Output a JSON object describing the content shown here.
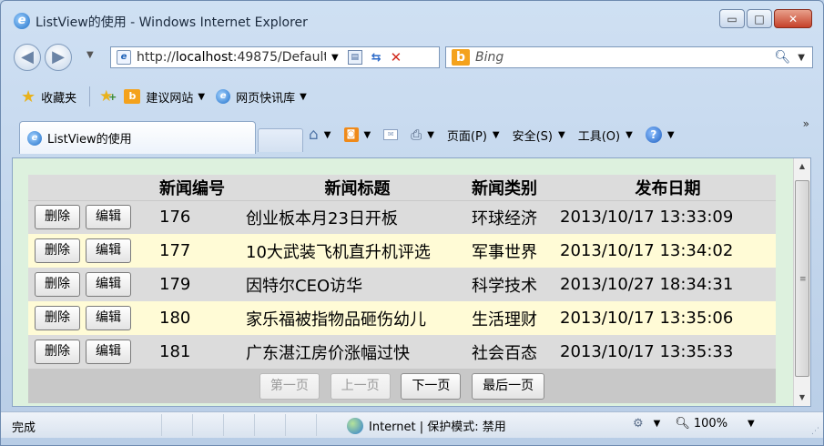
{
  "window": {
    "title": "ListView的使用 - Windows Internet Explorer",
    "minimize_glyph": "▭",
    "maximize_glyph": "□",
    "close_glyph": "✕"
  },
  "address": {
    "url_prefix": "http://",
    "url_host": "localhost",
    "url_rest": ":49875/Default",
    "search_placeholder": "Bing"
  },
  "favorites": {
    "label": "收藏夹",
    "items": [
      {
        "label": "建议网站"
      },
      {
        "label": "网页快讯库"
      }
    ]
  },
  "tab": {
    "label": "ListView的使用"
  },
  "commands": {
    "page": "页面(P)",
    "safety": "安全(S)",
    "tools": "工具(O)"
  },
  "listview": {
    "headers": [
      "新闻编号",
      "新闻标题",
      "新闻类别",
      "发布日期"
    ],
    "delete_label": "删除",
    "edit_label": "编辑",
    "rows": [
      {
        "id": "176",
        "title": "创业板本月23日开板",
        "category": "环球经济",
        "date": "2013/10/17 13:33:09"
      },
      {
        "id": "177",
        "title": "10大武装飞机直升机评选",
        "category": "军事世界",
        "date": "2013/10/17 13:34:02"
      },
      {
        "id": "179",
        "title": "因特尔CEO访华",
        "category": "科学技术",
        "date": "2013/10/27 18:34:31"
      },
      {
        "id": "180",
        "title": "家乐福被指物品砸伤幼儿",
        "category": "生活理财",
        "date": "2013/10/17 13:35:06"
      },
      {
        "id": "181",
        "title": "广东湛江房价涨幅过快",
        "category": "社会百态",
        "date": "2013/10/17 13:35:33"
      }
    ],
    "pager": {
      "first": "第一页",
      "prev": "上一页",
      "next": "下一页",
      "last": "最后一页"
    }
  },
  "status": {
    "text": "完成",
    "zone": "Internet | 保护模式: 禁用",
    "zoom": "100%"
  },
  "colors": {
    "content_bg": "#ddf1de",
    "row_even": "#dcdcdc",
    "row_odd": "#fffbd6"
  }
}
